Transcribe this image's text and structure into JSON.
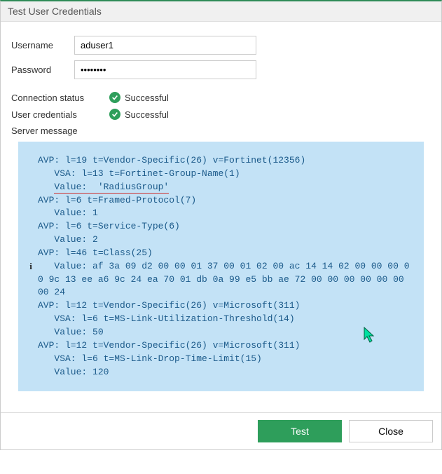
{
  "title": "Test User Credentials",
  "form": {
    "username_label": "Username",
    "username_value": "aduser1",
    "password_label": "Password",
    "password_value": "••••••••"
  },
  "status": {
    "connection_label": "Connection status",
    "connection_value": "Successful",
    "credentials_label": "User credentials",
    "credentials_value": "Successful",
    "server_message_label": "Server message"
  },
  "server_message": {
    "l1": "AVP: l=19 t=Vendor-Specific(26) v=Fortinet(12356)",
    "l2": "   VSA: l=13 t=Fortinet-Group-Name(1)",
    "l3p": "   ",
    "l3u": "Value:  'RadiusGroup'",
    "l4": "AVP: l=6 t=Framed-Protocol(7)",
    "l5": "   Value: 1",
    "l6": "AVP: l=6 t=Service-Type(6)",
    "l7": "   Value: 2",
    "l8": "AVP: l=46 t=Class(25)",
    "l9": "   Value: af 3a 09 d2 00 00 01 37 00 01 02 00 ac 14 14 02 00 00 00 00 9c 13 ee a6 9c 24 ea 70 01 db 0a 99 e5 bb ae 72 00 00 00 00 00 00 00 24",
    "l10": "AVP: l=12 t=Vendor-Specific(26) v=Microsoft(311)",
    "l11": "   VSA: l=6 t=MS-Link-Utilization-Threshold(14)",
    "l12": "   Value: 50",
    "l13": "AVP: l=12 t=Vendor-Specific(26) v=Microsoft(311)",
    "l14": "   VSA: l=6 t=MS-Link-Drop-Time-Limit(15)",
    "l15": "   Value: 120"
  },
  "buttons": {
    "test": "Test",
    "close": "Close"
  }
}
